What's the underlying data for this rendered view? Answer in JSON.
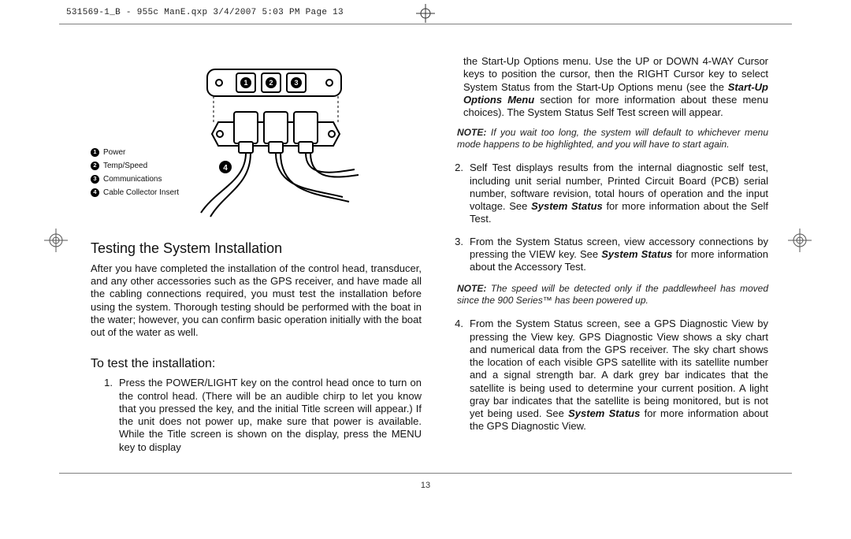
{
  "meta": {
    "header_line": "531569-1_B - 955c ManE.qxp  3/4/2007  5:03 PM  Page 13",
    "page_number": "13"
  },
  "legend": {
    "items": [
      {
        "n": "1",
        "label": "Power"
      },
      {
        "n": "2",
        "label": "Temp/Speed"
      },
      {
        "n": "3",
        "label": "Communications"
      },
      {
        "n": "4",
        "label": "Cable Collector Insert"
      }
    ]
  },
  "leftcol": {
    "h1": "Testing the System Installation",
    "intro": "After you have completed the installation of the control head, transducer, and any other accessories such as the GPS receiver, and have made all the cabling connections required, you must test the installation before using the system. Thorough testing should be performed with the boat in the water; however, you can confirm basic operation initially with the boat out of the water as well.",
    "h2": "To test the installation:",
    "step1_num": "1.",
    "step1": "Press the POWER/LIGHT key on the control head once to turn on the control head. (There will be an audible chirp to let you know that you pressed the key, and the initial Title screen will appear.) If the unit does not power up, make sure that power is available. While the Title screen is shown on the display, press the MENU key to display"
  },
  "rightcol": {
    "step1_cont_a": "the Start-Up Options menu. Use the UP or DOWN 4-WAY Cursor keys to position the cursor, then the RIGHT Cursor key to select System Status from the Start-Up Options menu (see the ",
    "step1_bi_a": "Start-Up Options Menu",
    "step1_cont_b": " section for more information about these menu choices). The System Status Self Test screen will appear.",
    "note1_lbl": "NOTE:",
    "note1": " If you wait too long, the system will default to whichever menu mode happens to be highlighted, and you will have to start again.",
    "step2_num": "2.",
    "step2_a": "Self Test displays results from the internal diagnostic self test, including unit serial number, Printed Circuit Board (PCB) serial number, software revision, total hours of operation and the input voltage. See ",
    "step2_bi": "System Status",
    "step2_b": " for more information about the Self Test.",
    "step3_num": "3.",
    "step3_a": "From the System Status screen, view accessory connections by pressing the VIEW key. See ",
    "step3_bi": "System Status",
    "step3_b": " for more information about the Accessory Test.",
    "note2_lbl": "NOTE:",
    "note2_a": " The speed will be detected only if the paddlewheel has moved since the 900 Series",
    "note2_tm": "™",
    "note2_b": " has been powered up.",
    "step4_num": "4.",
    "step4_a": "From the System Status screen, see a GPS Diagnostic View by pressing the View key. GPS Diagnostic View shows a sky chart and numerical data from the GPS receiver. The sky chart shows the location of each visible GPS satellite with its satellite number and a signal strength bar. A dark grey bar indicates that the satellite is being used to determine your current position. A light gray bar indicates that the satellite is being monitored, but is not yet being used. See ",
    "step4_bi": "System Status",
    "step4_b": " for more information about the GPS Diagnostic View."
  }
}
